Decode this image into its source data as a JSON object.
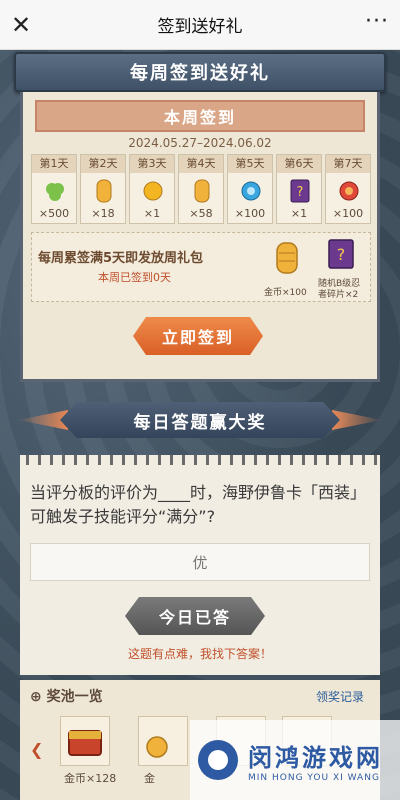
{
  "topbar": {
    "title": "签到送好礼",
    "close_glyph": "✕",
    "more_glyph": "···"
  },
  "weekly": {
    "banner": "每周签到送好礼",
    "header": "本周签到",
    "date_range": "2024.05.27–2024.06.02",
    "days": [
      {
        "label": "第1天",
        "count": "×500",
        "icon": "green-material-icon",
        "color": "#7cc24a"
      },
      {
        "label": "第2天",
        "count": "×18",
        "icon": "gold-coin-stack-icon",
        "color": "#f0b23a"
      },
      {
        "label": "第3天",
        "count": "×1",
        "icon": "gold-orb-icon",
        "color": "#f3b622"
      },
      {
        "label": "第4天",
        "count": "×58",
        "icon": "gold-coin-stack-icon",
        "color": "#f0b23a"
      },
      {
        "label": "第5天",
        "count": "×100",
        "icon": "blue-gem-icon",
        "color": "#3aa6df"
      },
      {
        "label": "第6天",
        "count": "×1",
        "icon": "mystery-fragment-icon",
        "color": "#6b3a8f"
      },
      {
        "label": "第7天",
        "count": "×100",
        "icon": "red-gem-icon",
        "color": "#e0483a"
      }
    ],
    "bonus": {
      "line1": "每周累签满5天即发放周礼包",
      "line2_prefix": "本周已签到",
      "line2_count": "0",
      "line2_suffix": "天",
      "item1_label": "金币×100",
      "item2_label": "随机B级忍者碎片×2"
    },
    "sign_button": "立即签到"
  },
  "quiz": {
    "banner": "每日答题赢大奖",
    "question": "当评分板的评价为____时，海野伊鲁卡「西装」可触发子技能评分“满分”?",
    "answer": "优",
    "done_button": "今日已答",
    "hint": "这题有点难，我找下答案！"
  },
  "pool": {
    "title": "奖池一览",
    "record_link": "领奖记录",
    "prize1_label": "金币×128",
    "prize2_label": "金"
  },
  "watermark": {
    "cn": "闵鸿游戏网",
    "en": "MIN HONG YOU XI WANG"
  }
}
